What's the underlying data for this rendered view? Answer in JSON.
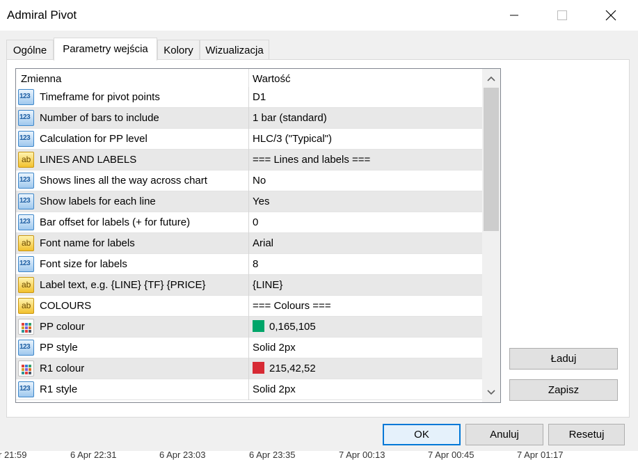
{
  "window": {
    "title": "Admiral Pivot"
  },
  "tabs": [
    {
      "label": "Ogólne"
    },
    {
      "label": "Parametry wejścia"
    },
    {
      "label": "Kolory"
    },
    {
      "label": "Wizualizacja"
    }
  ],
  "grid": {
    "header": {
      "col1": "Zmienna",
      "col2": "Wartość"
    },
    "rows": [
      {
        "type": "num",
        "name": "Timeframe for pivot points",
        "value": "D1"
      },
      {
        "type": "num",
        "name": "Number of bars to include",
        "value": "1 bar (standard)"
      },
      {
        "type": "num",
        "name": "Calculation for PP level",
        "value": "HLC/3 (\"Typical\")"
      },
      {
        "type": "text",
        "name": "LINES AND LABELS",
        "value": "=== Lines and labels ==="
      },
      {
        "type": "num",
        "name": "Shows lines all the way across chart",
        "value": "No"
      },
      {
        "type": "num",
        "name": "Show labels for each line",
        "value": "Yes"
      },
      {
        "type": "num",
        "name": "Bar offset for labels (+ for future)",
        "value": "0"
      },
      {
        "type": "text",
        "name": "Font name for labels",
        "value": "Arial"
      },
      {
        "type": "num",
        "name": "Font size for labels",
        "value": "8"
      },
      {
        "type": "text",
        "name": "Label text, e.g. {LINE} {TF} {PRICE}",
        "value": "{LINE}"
      },
      {
        "type": "text",
        "name": "COLOURS",
        "value": "=== Colours ==="
      },
      {
        "type": "color",
        "name": "PP colour",
        "value": "0,165,105",
        "swatch": "#00a569"
      },
      {
        "type": "num",
        "name": "PP style",
        "value": "Solid 2px"
      },
      {
        "type": "color",
        "name": "R1 colour",
        "value": "215,42,52",
        "swatch": "#d72a34"
      },
      {
        "type": "num",
        "name": "R1 style",
        "value": "Solid 2px"
      }
    ]
  },
  "icons": {
    "num": "123",
    "text": "ab"
  },
  "side_buttons": {
    "load": "Ładuj",
    "save": "Zapisz"
  },
  "footer_buttons": {
    "ok": "OK",
    "cancel": "Anuluj",
    "reset": "Resetuj"
  },
  "background_axis": [
    "r 21:59",
    "6 Apr 22:31",
    "6 Apr 23:03",
    "6 Apr 23:35",
    "7 Apr 00:13",
    "7 Apr 00:45",
    "7 Apr 01:17"
  ]
}
